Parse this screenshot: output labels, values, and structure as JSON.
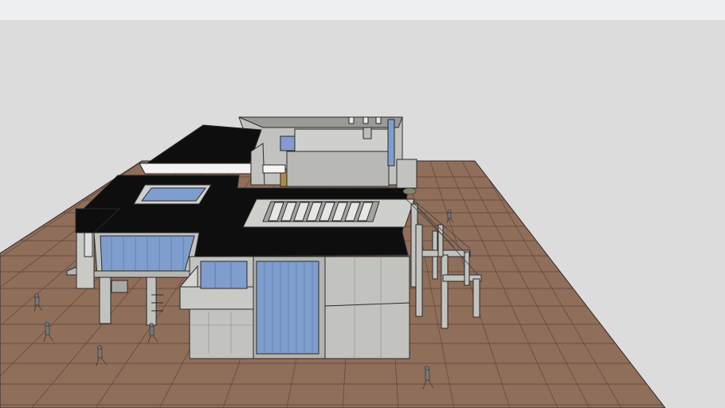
{
  "scene": {
    "colors": {
      "sky_band": "#eef0f1",
      "background": "#dcdcdc",
      "ground": "#8f6e5a",
      "ground_lines": "#5f4638",
      "roof": "#0e0e0e",
      "concrete": "#c2c2bf",
      "concrete_dark": "#9a9a97",
      "glass": "#7f9ecd",
      "outline": "#2a2a2a"
    }
  }
}
